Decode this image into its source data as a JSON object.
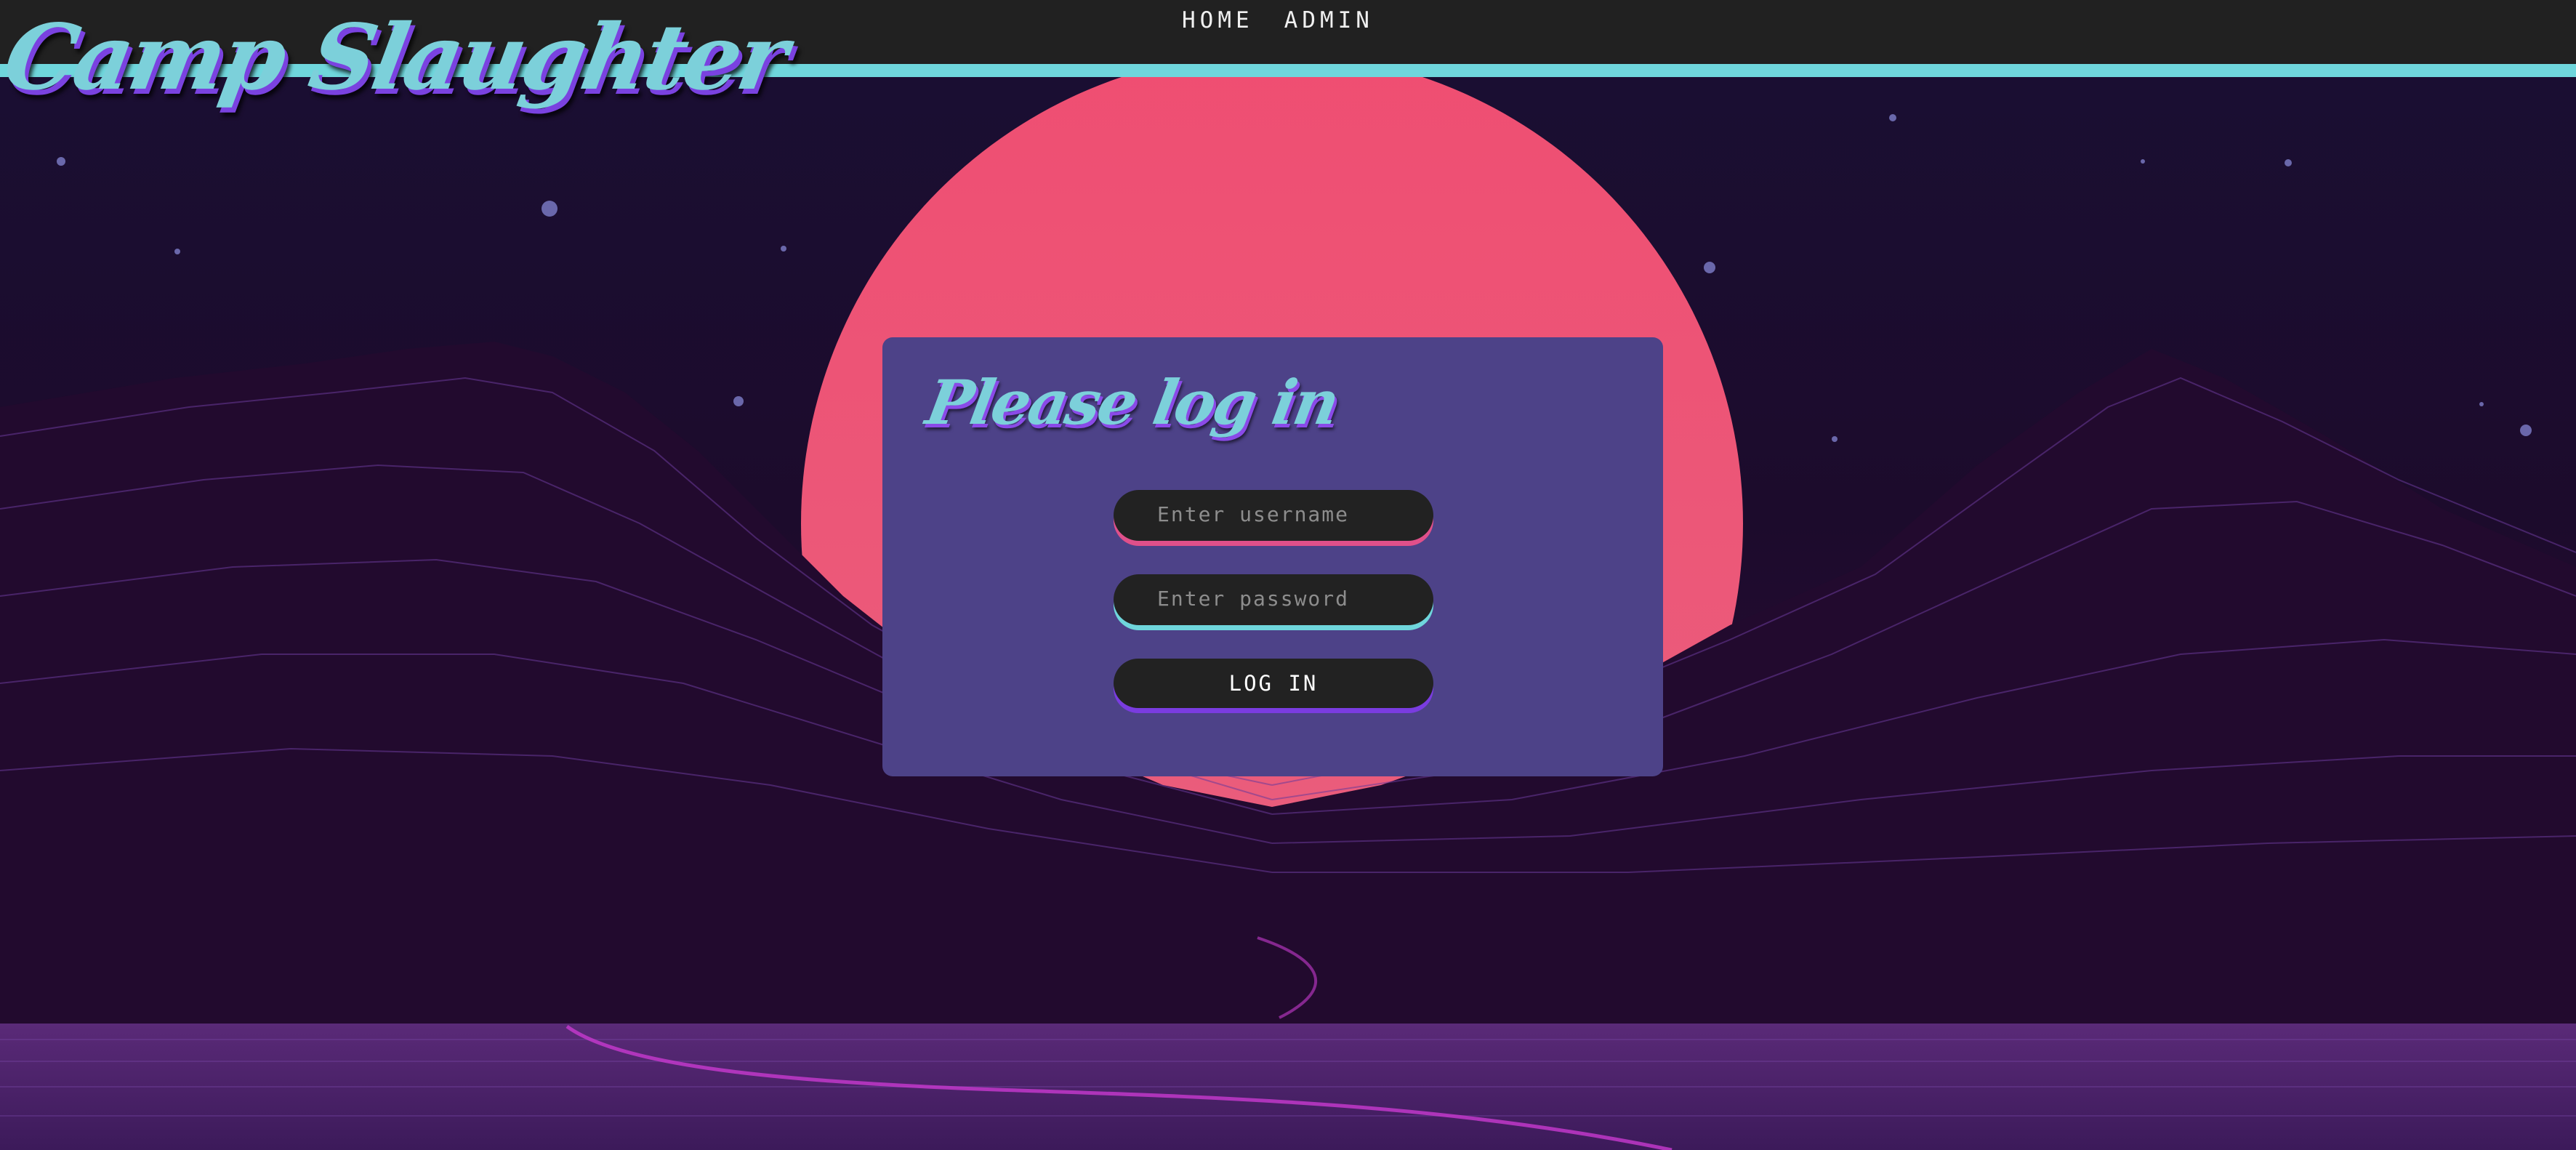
{
  "header": {
    "logo_text": "Camp Slaughter",
    "nav": [
      {
        "label": "HOME"
      },
      {
        "label": "ADMIN"
      }
    ]
  },
  "login": {
    "title": "Please log in",
    "username_placeholder": "Enter username",
    "username_value": "",
    "password_placeholder": "Enter password",
    "password_value": "",
    "submit_label": "LOG IN"
  },
  "colors": {
    "header_bg": "#212121",
    "accent_cyan": "#6fd6dc",
    "accent_pink": "#e0508a",
    "accent_purple": "#7a3ce0",
    "card_bg": "#4d4288",
    "sun": "#ef5577"
  }
}
